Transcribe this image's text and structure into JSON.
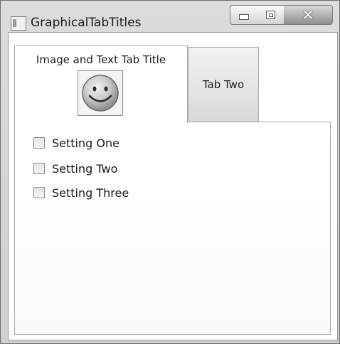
{
  "window": {
    "title": "GraphicalTabTitles"
  },
  "titlebar": {
    "icon": "app-window-icon",
    "controls": [
      "minimize",
      "maximize",
      "close"
    ],
    "close_glyph": "✕"
  },
  "tabs": [
    {
      "label": "Image and Text Tab Title",
      "icon": "smiley-face-icon",
      "selected": true
    },
    {
      "label": "Tab Two",
      "selected": false
    }
  ],
  "settings": [
    {
      "label": "Setting One",
      "checked": false
    },
    {
      "label": "Setting Two",
      "checked": false
    },
    {
      "label": "Setting Three",
      "checked": false
    }
  ]
}
